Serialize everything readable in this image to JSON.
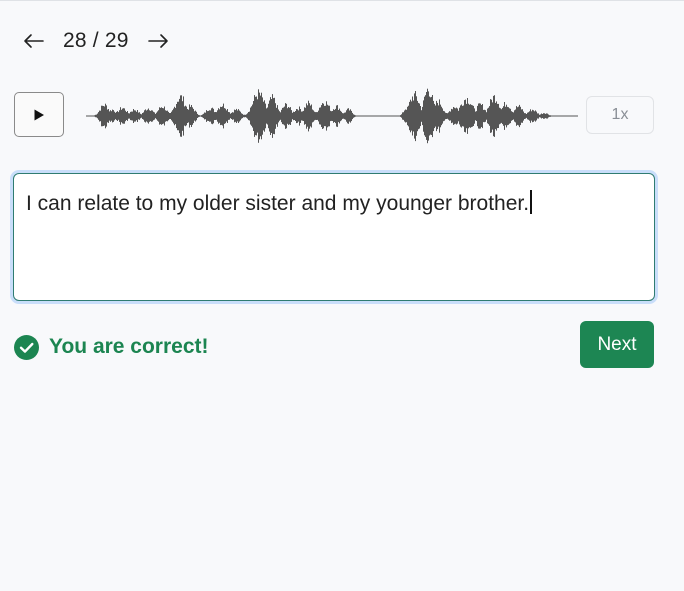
{
  "pager": {
    "counter": "28 / 29",
    "prev_icon": "arrow-left-icon",
    "next_icon": "arrow-right-icon"
  },
  "player": {
    "play_icon": "play-icon",
    "speed_label": "1x"
  },
  "answer": {
    "value": "I can relate to my older sister and my younger brother."
  },
  "feedback": {
    "message": "You are correct!",
    "icon": "check-circle-icon"
  },
  "actions": {
    "next_label": "Next"
  },
  "colors": {
    "success": "#1c8551",
    "next_button": "#1d8653",
    "focus_ring": "#c9defa",
    "input_border": "#2f7c71",
    "waveform": "#555555"
  }
}
